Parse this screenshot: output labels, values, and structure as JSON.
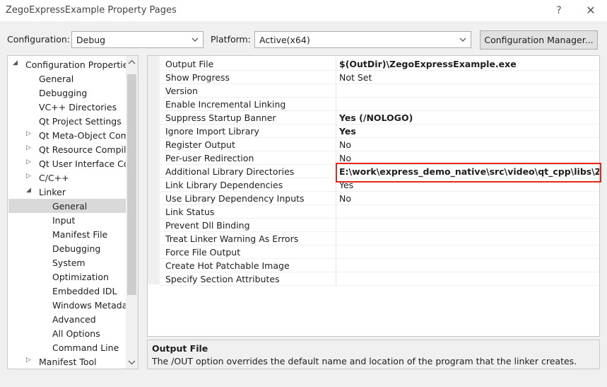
{
  "window": {
    "title": "ZegoExpressExample Property Pages",
    "help_glyph": "?",
    "close_glyph": "✕"
  },
  "config_bar": {
    "configuration_label": "Configuration:",
    "configuration_value": "Debug",
    "platform_label": "Platform:",
    "platform_value": "Active(x64)",
    "manager_button": "Configuration Manager..."
  },
  "tree": {
    "items": [
      {
        "label": "Configuration Properties",
        "expander": "◢",
        "depth": 0
      },
      {
        "label": "General",
        "expander": "",
        "depth": 1
      },
      {
        "label": "Debugging",
        "expander": "",
        "depth": 1
      },
      {
        "label": "VC++ Directories",
        "expander": "",
        "depth": 1
      },
      {
        "label": "Qt Project Settings",
        "expander": "",
        "depth": 1
      },
      {
        "label": "Qt Meta-Object Compiler",
        "expander": "▷",
        "depth": 1
      },
      {
        "label": "Qt Resource Compiler",
        "expander": "▷",
        "depth": 1
      },
      {
        "label": "Qt User Interface Compiler",
        "expander": "▷",
        "depth": 1
      },
      {
        "label": "C/C++",
        "expander": "▷",
        "depth": 1
      },
      {
        "label": "Linker",
        "expander": "◢",
        "depth": 1
      },
      {
        "label": "General",
        "expander": "",
        "depth": 2,
        "selected": true
      },
      {
        "label": "Input",
        "expander": "",
        "depth": 2
      },
      {
        "label": "Manifest File",
        "expander": "",
        "depth": 2
      },
      {
        "label": "Debugging",
        "expander": "",
        "depth": 2
      },
      {
        "label": "System",
        "expander": "",
        "depth": 2
      },
      {
        "label": "Optimization",
        "expander": "",
        "depth": 2
      },
      {
        "label": "Embedded IDL",
        "expander": "",
        "depth": 2
      },
      {
        "label": "Windows Metadata",
        "expander": "",
        "depth": 2
      },
      {
        "label": "Advanced",
        "expander": "",
        "depth": 2
      },
      {
        "label": "All Options",
        "expander": "",
        "depth": 2
      },
      {
        "label": "Command Line",
        "expander": "",
        "depth": 2
      },
      {
        "label": "Manifest Tool",
        "expander": "▷",
        "depth": 1
      }
    ]
  },
  "properties": {
    "rows": [
      {
        "name": "Output File",
        "value": "$(OutDir)\\ZegoExpressExample.exe",
        "bold": true
      },
      {
        "name": "Show Progress",
        "value": "Not Set",
        "bold": false
      },
      {
        "name": "Version",
        "value": "",
        "bold": false
      },
      {
        "name": "Enable Incremental Linking",
        "value": "",
        "bold": false
      },
      {
        "name": "Suppress Startup Banner",
        "value": "Yes (/NOLOGO)",
        "bold": true
      },
      {
        "name": "Ignore Import Library",
        "value": "Yes",
        "bold": true
      },
      {
        "name": "Register Output",
        "value": "No",
        "bold": false
      },
      {
        "name": "Per-user Redirection",
        "value": "No",
        "bold": false
      },
      {
        "name": "Additional Library Directories",
        "value": "E:\\work\\express_demo_native\\src\\video\\qt_cpp\\libs\\ZegoExpress",
        "bold": true
      },
      {
        "name": "Link Library Dependencies",
        "value": "Yes",
        "bold": false
      },
      {
        "name": "Use Library Dependency Inputs",
        "value": "No",
        "bold": false
      },
      {
        "name": "Link Status",
        "value": "",
        "bold": false
      },
      {
        "name": "Prevent Dll Binding",
        "value": "",
        "bold": false
      },
      {
        "name": "Treat Linker Warning As Errors",
        "value": "",
        "bold": false
      },
      {
        "name": "Force File Output",
        "value": "",
        "bold": false
      },
      {
        "name": "Create Hot Patchable Image",
        "value": "",
        "bold": false
      },
      {
        "name": "Specify Section Attributes",
        "value": "",
        "bold": false
      }
    ]
  },
  "description": {
    "title": "Output File",
    "text": "The /OUT option overrides the default name and location of the program that the linker creates."
  },
  "colors": {
    "highlight_border": "#e8261b",
    "selected_row": "#d9d9d9"
  }
}
